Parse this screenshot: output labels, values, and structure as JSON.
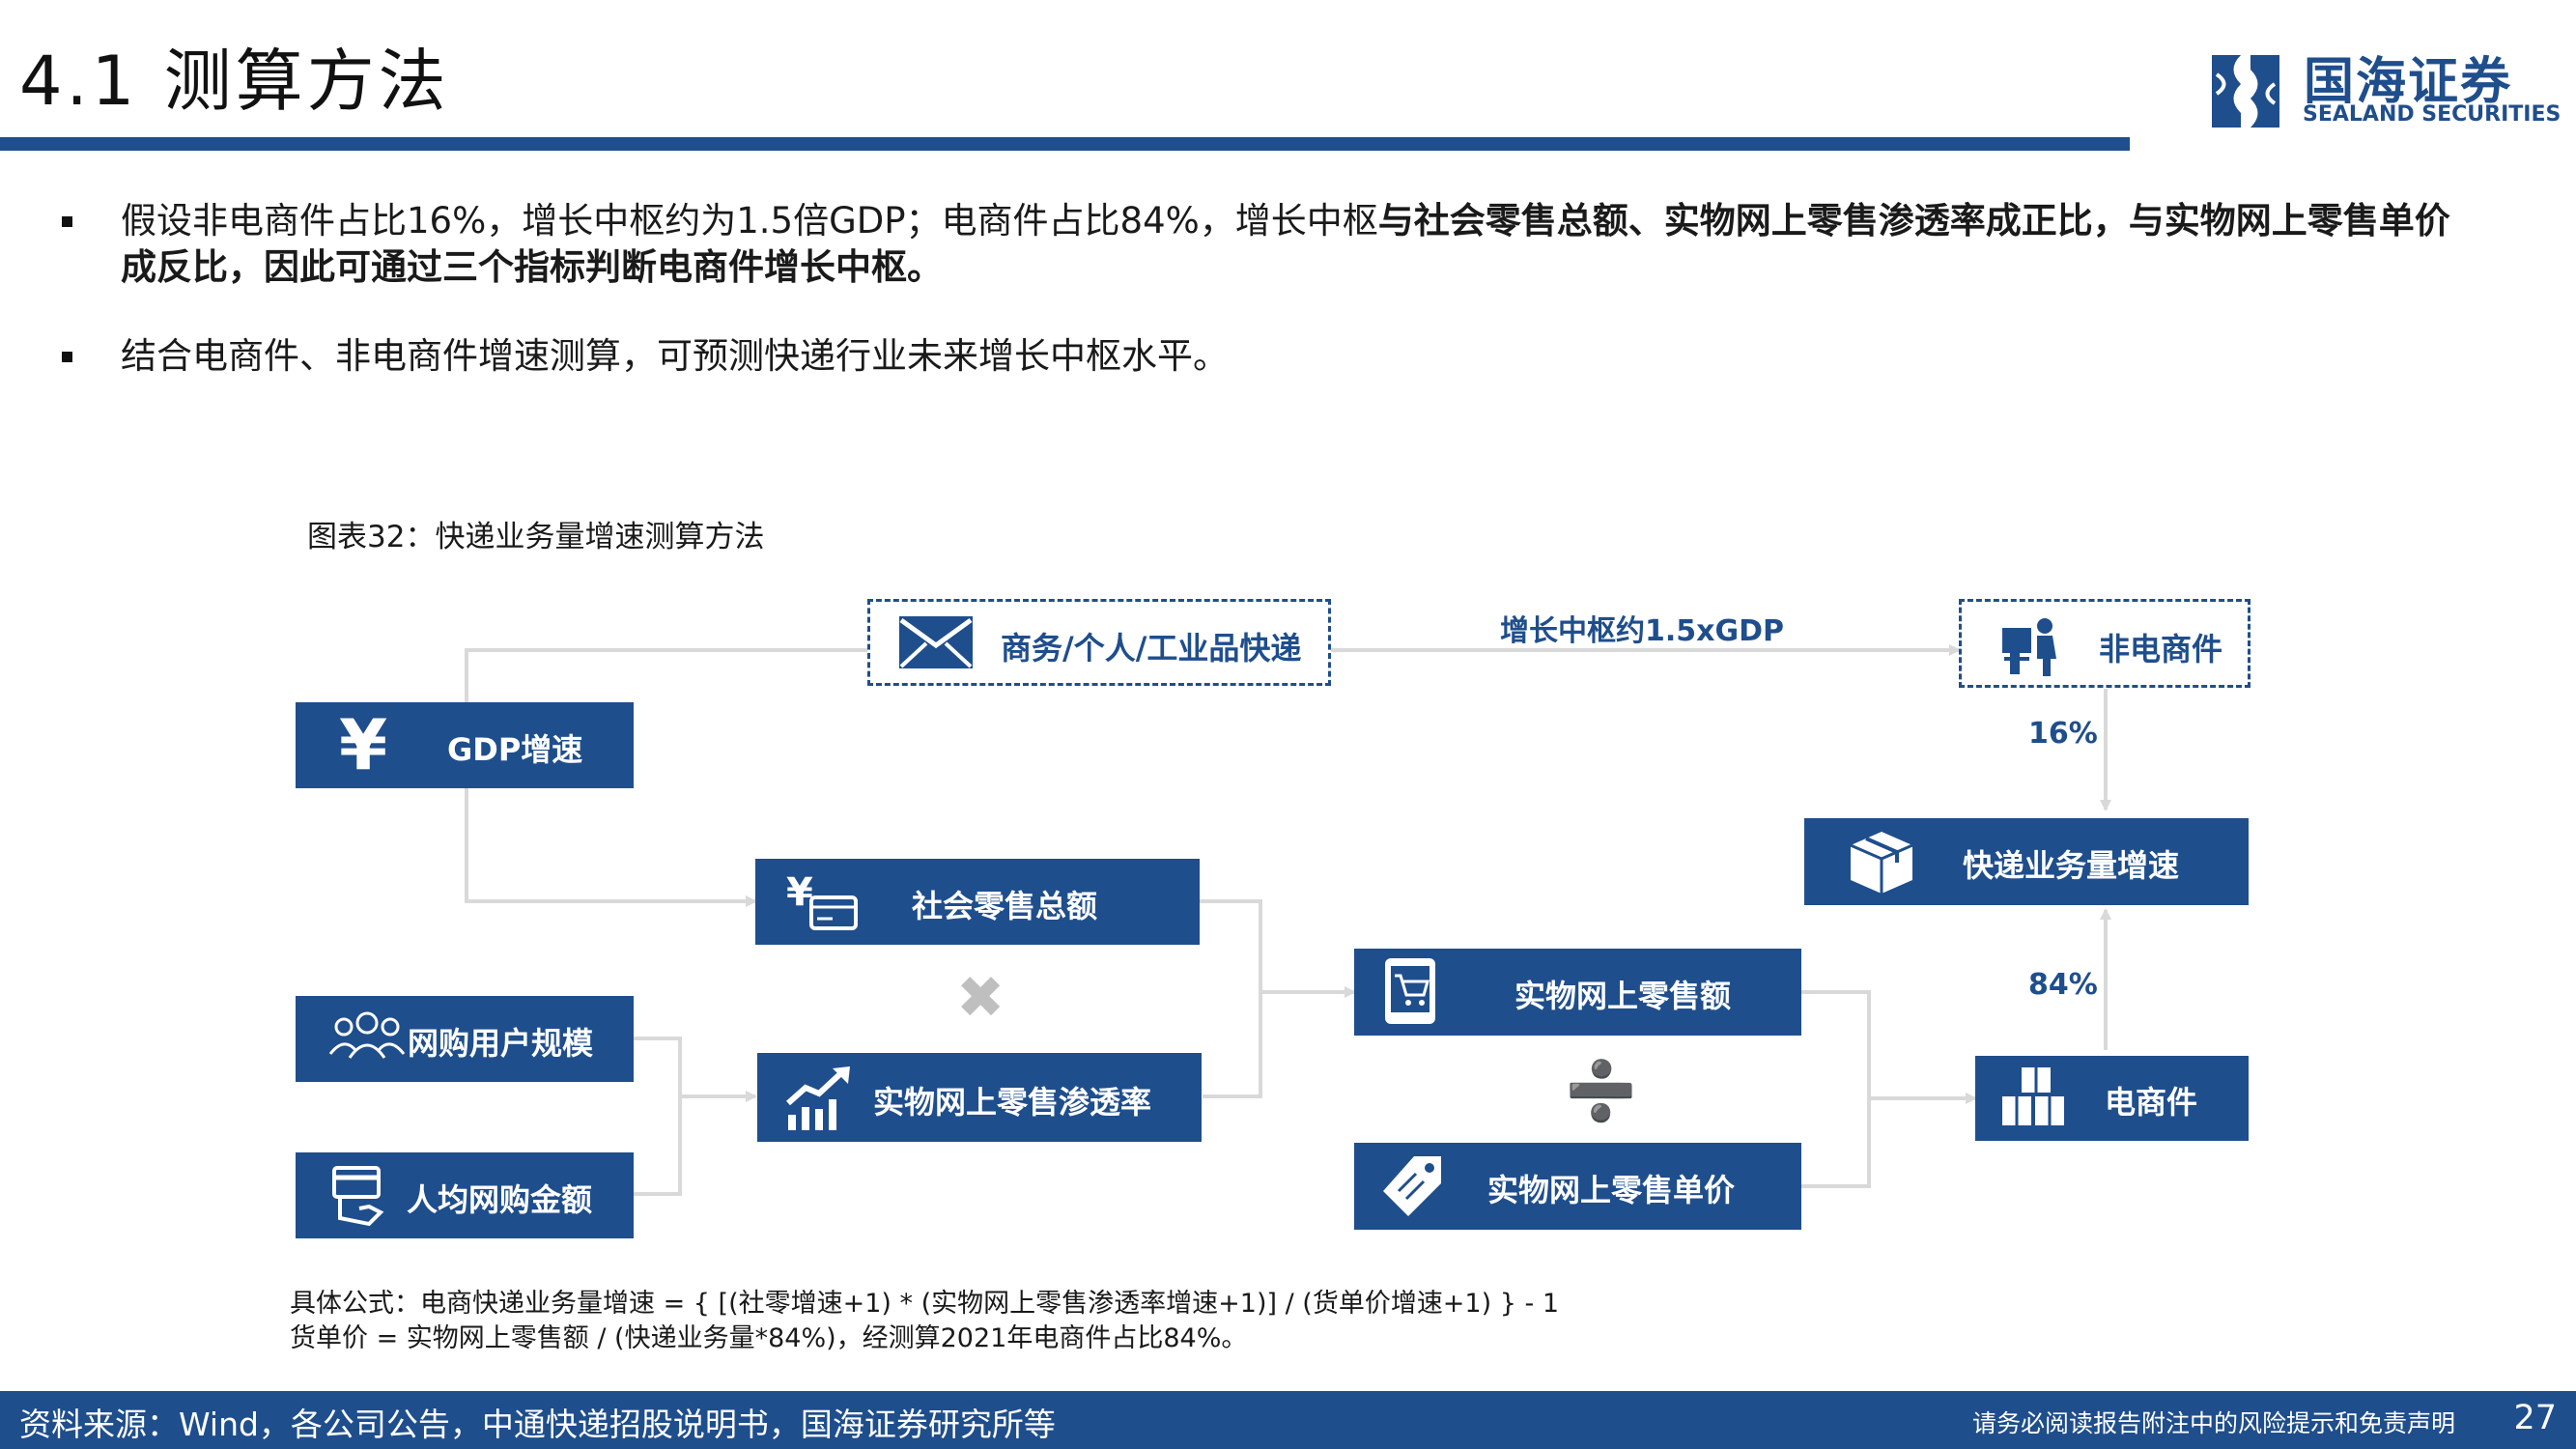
{
  "header": {
    "title": "4.1 测算方法",
    "logo_cn": "国海证券",
    "logo_en": "SEALAND SECURITIES"
  },
  "bullets": [
    {
      "normal": "假设非电商件占比16%，增长中枢约为1.5倍GDP；电商件占比84%，增长中枢",
      "bold": "与社会零售总额、实物网上零售渗透率成正比，与实物网上零售单价成反比，因此可通过三个指标判断电商件增长中枢。"
    },
    {
      "normal": "结合电商件、非电商件增速测算，可预测快递行业未来增长中枢水平。",
      "bold": ""
    }
  ],
  "figure": {
    "title": "图表32：快递业务量增速测算方法",
    "nodes": {
      "gdp": "GDP增速",
      "express_types": "商务/个人/工业品快递",
      "non_ecommerce": "非电商件",
      "retail_total": "社会零售总额",
      "online_users": "网购用户规模",
      "per_capita": "人均网购金额",
      "penetration": "实物网上零售渗透率",
      "online_retail": "实物网上零售额",
      "unit_price": "实物网上零售单价",
      "express_growth": "快递业务量增速",
      "ecommerce": "电商件"
    },
    "edge_labels": {
      "growth": "增长中枢约1.5xGDP",
      "non_ecom_pct": "16%",
      "ecom_pct": "84%"
    },
    "symbols": {
      "multiply": "✖",
      "divide": "➗"
    },
    "icons": {
      "gdp": "yen-icon",
      "express_types": "envelope-icon",
      "non_ecommerce": "delivery-person-icon",
      "retail_total": "yen-card-icon",
      "online_users": "users-icon",
      "per_capita": "card-hand-icon",
      "penetration": "growth-chart-icon",
      "online_retail": "phone-cart-icon",
      "unit_price": "price-tag-icon",
      "express_growth": "package-icon",
      "ecommerce": "boxes-icon"
    }
  },
  "formula": {
    "line1": "具体公式：电商快递业务量增速 = { [(社零增速+1) * (实物网上零售渗透率增速+1)] / (货单价增速+1) } - 1",
    "line2": "货单价 = 实物网上零售额 / (快递业务量*84%)，经测算2021年电商件占比84%。"
  },
  "footer": {
    "source": "资料来源：Wind，各公司公告，中通快递招股说明书，国海证券研究所等",
    "disclaimer": "请务必阅读报告附注中的风险提示和免责声明",
    "page": "27"
  },
  "colors": {
    "primary": "#1f4e8c",
    "connector": "#d9d9d9",
    "symbol": "#bfbfbf"
  }
}
